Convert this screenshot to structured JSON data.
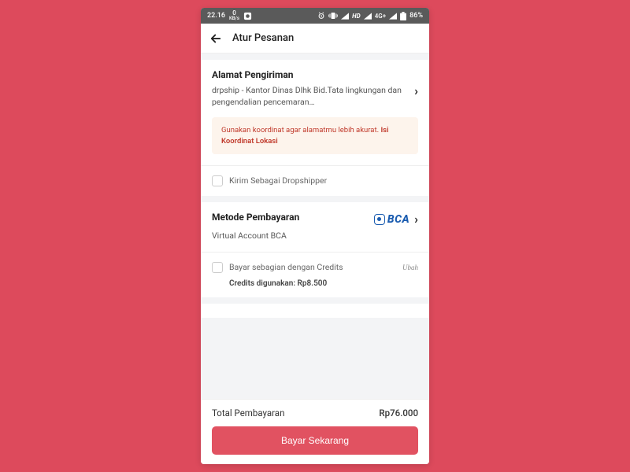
{
  "statusbar": {
    "time": "22.16",
    "net_speed": "0",
    "net_unit": "KB/s",
    "hd": "HD",
    "net": "4G+",
    "battery": "86%"
  },
  "appbar": {
    "title": "Atur Pesanan"
  },
  "address": {
    "heading": "Alamat Pengiriman",
    "text": "drpship - Kantor Dinas Dlhk Bid.Tata lingkungan dan pengendalian pencemaran…",
    "banner_text": "Gunakan koordinat agar alamatmu lebih akurat. ",
    "banner_link": "Isi Koordinat Lokasi",
    "dropship_label": "Kirim Sebagai Dropshipper"
  },
  "payment": {
    "heading": "Metode Pembayaran",
    "brand": "BCA",
    "subtitle": "Virtual Account BCA",
    "credits_label": "Bayar sebagian dengan Credits",
    "ubah": "Ubah",
    "credits_used": "Credits digunakan: Rp8.500"
  },
  "footer": {
    "total_label": "Total Pembayaran",
    "total_amount": "Rp76.000",
    "pay_button": "Bayar Sekarang"
  }
}
